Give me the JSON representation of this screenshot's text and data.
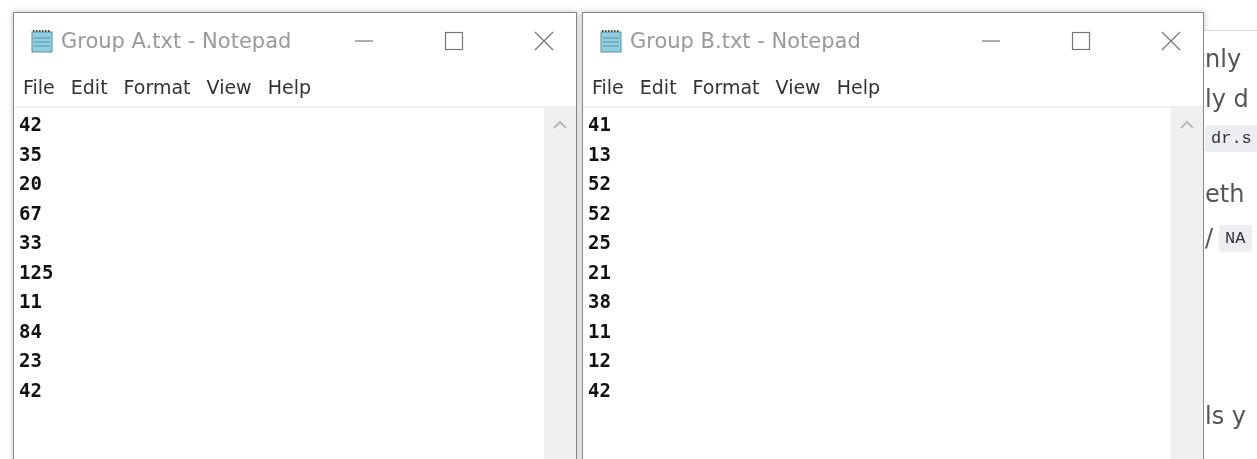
{
  "windows": [
    {
      "title": "Group A.txt - Notepad",
      "menu": [
        "File",
        "Edit",
        "Format",
        "View",
        "Help"
      ],
      "lines": [
        "42",
        "35",
        "20",
        "67",
        "33",
        "125",
        "11",
        "84",
        "23",
        "42"
      ]
    },
    {
      "title": "Group B.txt - Notepad",
      "menu": [
        "File",
        "Edit",
        "Format",
        "View",
        "Help"
      ],
      "lines": [
        "41",
        "13",
        "52",
        "52",
        "25",
        "21",
        "38",
        "11",
        "12",
        "42"
      ]
    }
  ],
  "background_page": {
    "rows": [
      [
        {
          "kind": "text",
          "text": "nly"
        }
      ],
      [
        {
          "kind": "text",
          "text": "ly d"
        }
      ],
      [
        {
          "kind": "code",
          "text": "dr.s"
        }
      ],
      [
        {
          "kind": "text",
          "text": "eth"
        }
      ],
      [
        {
          "kind": "text",
          "text": "/"
        },
        {
          "kind": "code",
          "text": "NA"
        }
      ],
      [
        {
          "kind": "text",
          "text": "ls y"
        }
      ]
    ]
  }
}
